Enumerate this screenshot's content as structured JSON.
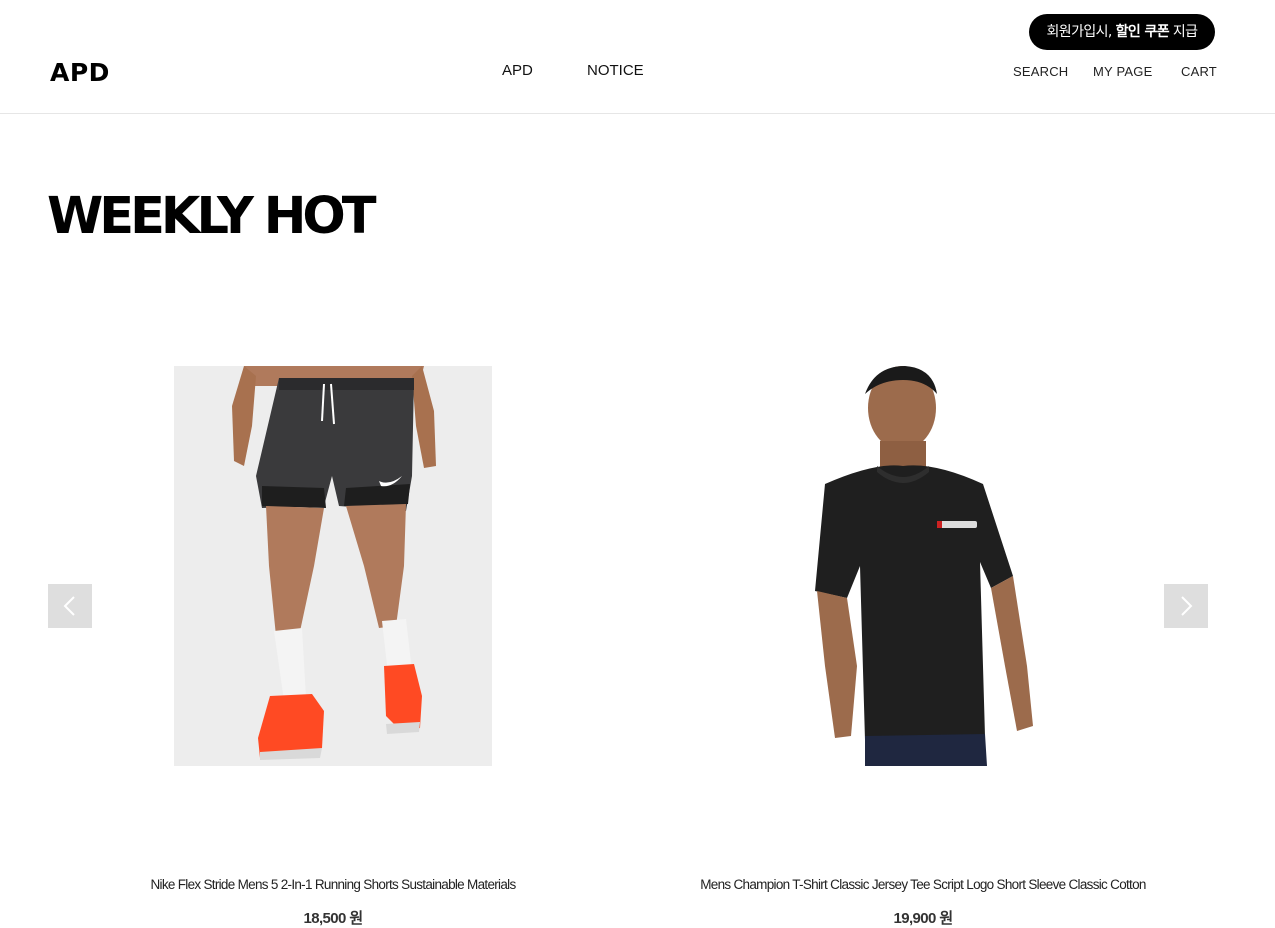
{
  "header": {
    "logo": "APD",
    "promo": {
      "prefix": "회원가입시, ",
      "highlight": "할인 쿠폰",
      "suffix": " 지급"
    },
    "nav": [
      {
        "label": "APD"
      },
      {
        "label": "NOTICE"
      }
    ],
    "util": {
      "search": "SEARCH",
      "mypage": "MY PAGE",
      "cart": "CART"
    }
  },
  "section": {
    "title": "WEEKLY HOT"
  },
  "carousel": {
    "prev_icon": "chevron-left-icon",
    "next_icon": "chevron-right-icon",
    "products": [
      {
        "name": "Nike Flex Stride Mens 5 2-In-1 Running Shorts Sustainable Materials",
        "price": "18,500 원",
        "image": "running-shorts-photo"
      },
      {
        "name": "Mens Champion T-Shirt Classic Jersey Tee Script Logo Short Sleeve Classic Cotton",
        "price": "19,900 원",
        "image": "black-tshirt-photo"
      }
    ]
  },
  "colors": {
    "promo_bg": "#000000",
    "divider": "#e6e6e6",
    "arrow_bg": "#d9d9d9",
    "shoe_accent": "#ff4a23"
  }
}
